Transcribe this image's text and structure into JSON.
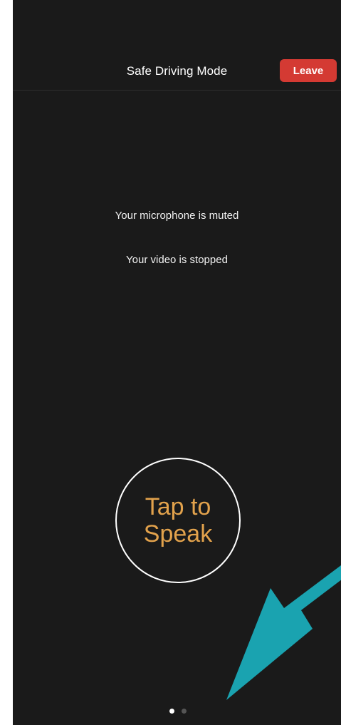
{
  "header": {
    "title": "Safe Driving Mode",
    "leave_label": "Leave"
  },
  "status": {
    "microphone": "Your microphone is muted",
    "video": "Your video is stopped"
  },
  "speak_button": {
    "line1": "Tap to",
    "line2": "Speak"
  },
  "pager": {
    "page_count": 2,
    "current_page": 1
  },
  "colors": {
    "background": "#1a1a1a",
    "leave_button": "#d43a33",
    "speak_text": "#e2a24c",
    "annotation_arrow": "#1aa3b0"
  },
  "annotation": {
    "icon": "arrow-pointer-icon"
  }
}
